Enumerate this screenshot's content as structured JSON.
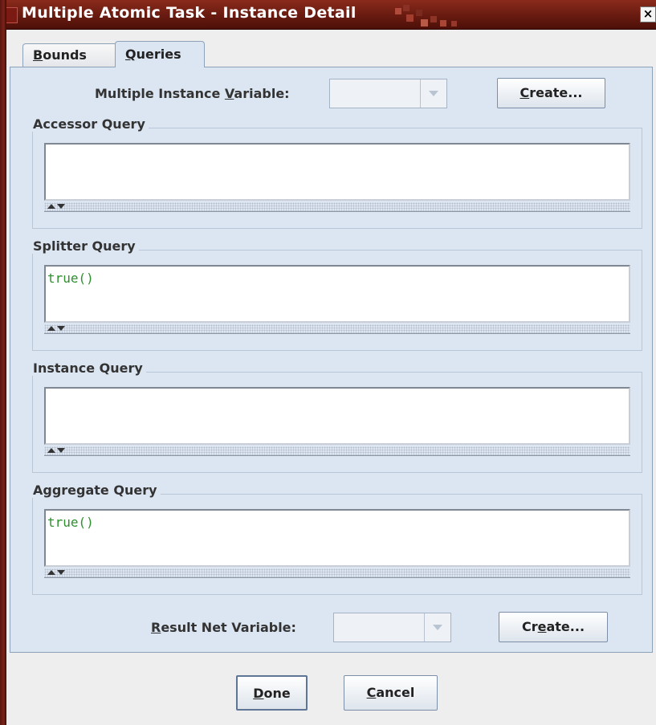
{
  "window": {
    "title": "Multiple Atomic Task - Instance Detail",
    "close_glyph": "×"
  },
  "tabs": [
    {
      "mnemonic": "B",
      "rest": "ounds",
      "selected": false
    },
    {
      "mnemonic": "Q",
      "rest": "ueries",
      "selected": true
    }
  ],
  "mi_variable": {
    "label_pre": "Multiple Instance ",
    "label_mn": "V",
    "label_post": "ariable:",
    "value": "",
    "create_mn": "C",
    "create_rest": "reate..."
  },
  "queries": [
    {
      "title": "Accessor Query",
      "value": ""
    },
    {
      "title": "Splitter Query",
      "value": "true()"
    },
    {
      "title": "Instance Query",
      "value": ""
    },
    {
      "title": "Aggregate Query",
      "value": "true()"
    }
  ],
  "result_variable": {
    "label_mn": "R",
    "label_rest": "esult Net Variable:",
    "value": "",
    "create_pre": "Cr",
    "create_mn": "e",
    "create_post": "ate..."
  },
  "footer": {
    "done_mn": "D",
    "done_rest": "one",
    "cancel_mn": "C",
    "cancel_rest": "ancel"
  },
  "colors": {
    "title_bar": "#6e1d12",
    "panel": "#dce6f2",
    "query_text": "#2d8f2d"
  },
  "icons": [
    "window-menu-icon",
    "title-decoration-icon",
    "close-icon",
    "dropdown-arrow-icon",
    "collapse-up-icon",
    "expand-down-icon"
  ]
}
